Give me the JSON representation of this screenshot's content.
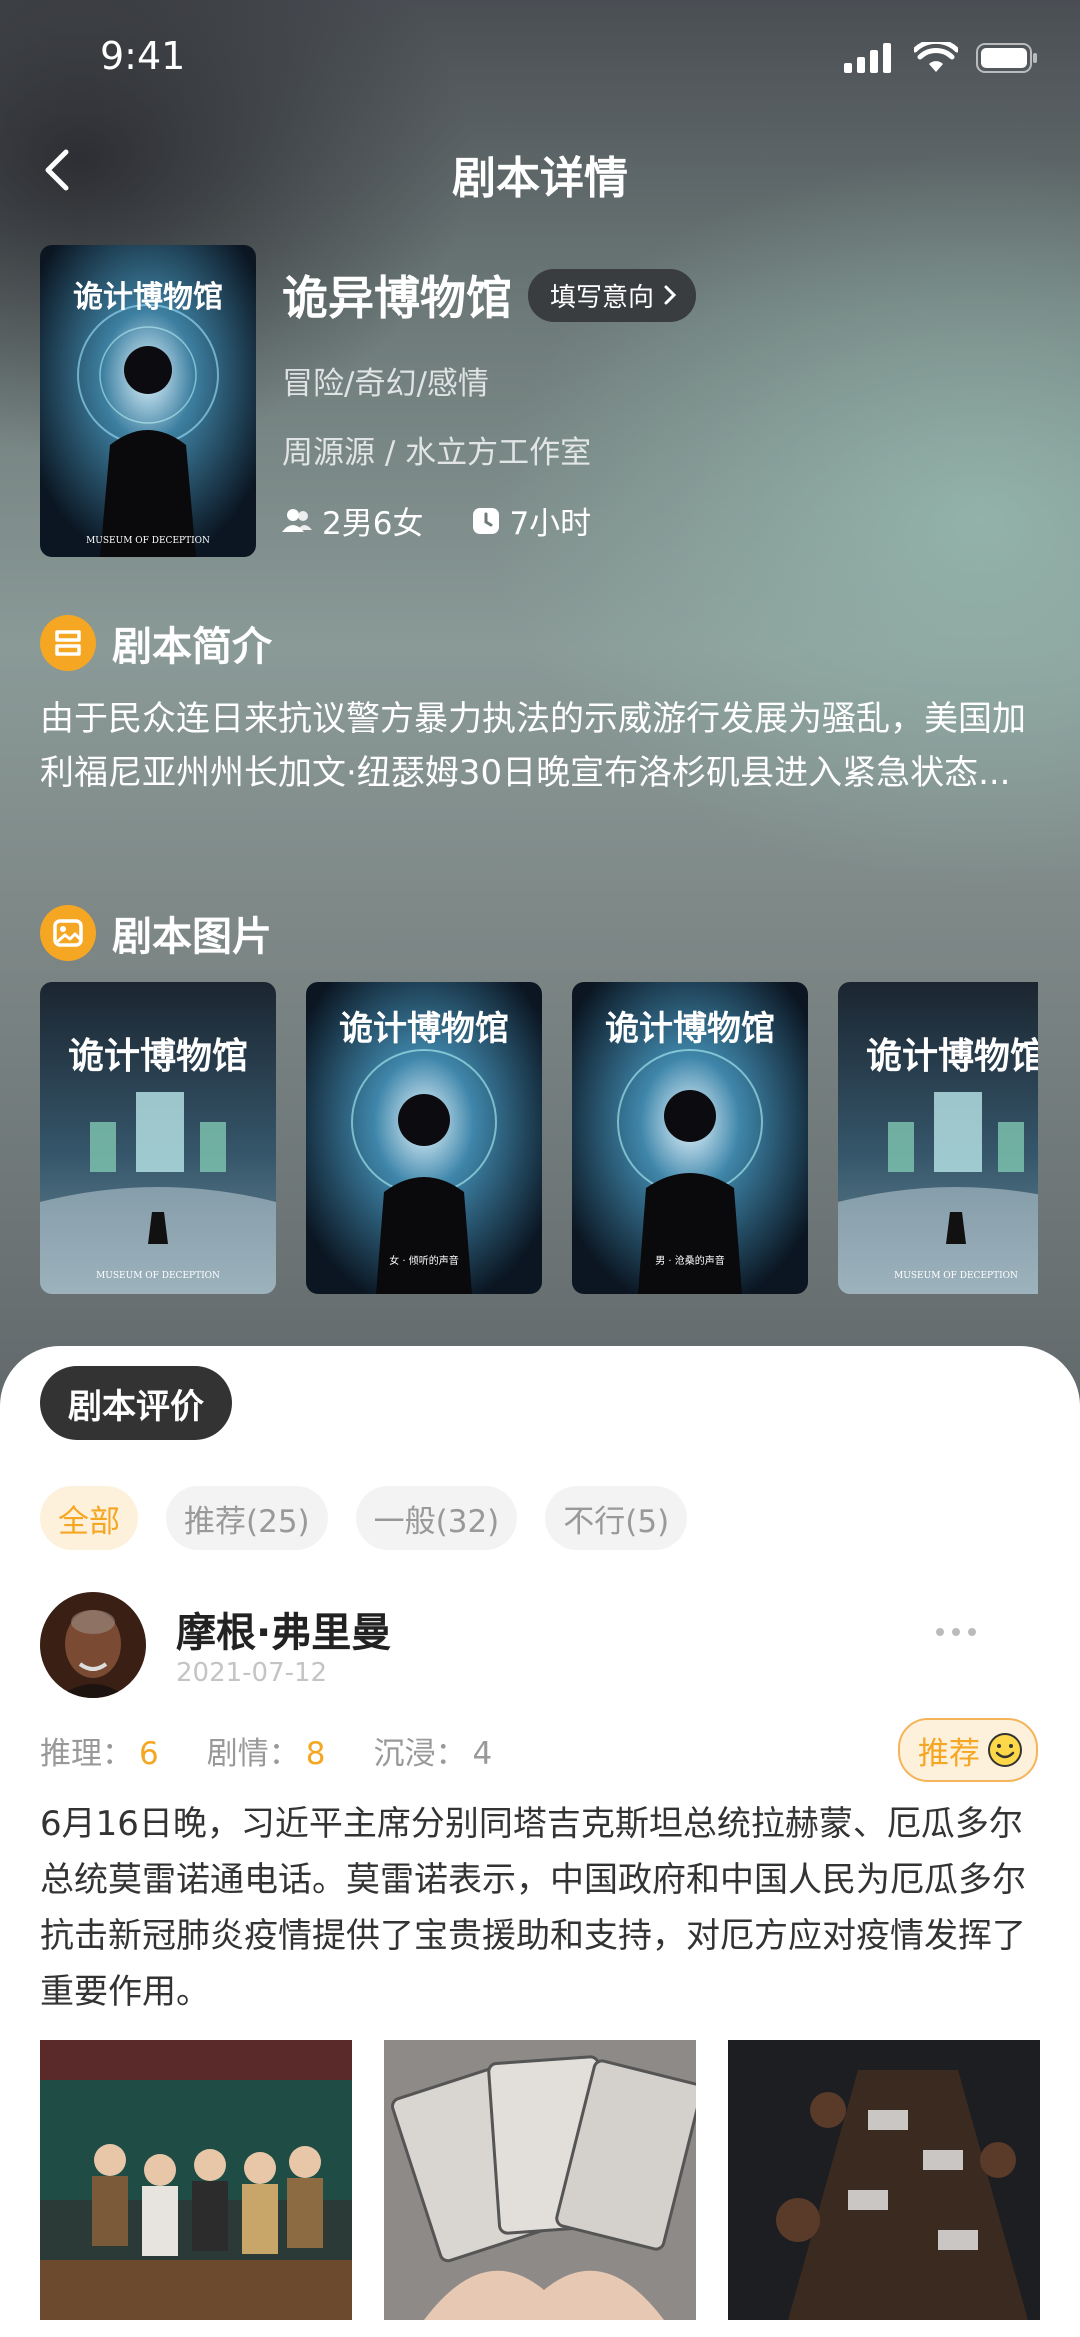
{
  "status_bar": {
    "time": "9:41"
  },
  "nav": {
    "title": "剧本详情"
  },
  "script": {
    "name": "诡异博物馆",
    "intent_label": "填写意向",
    "genre": "冒险/奇幻/感情",
    "author": "周源源 / 水立方工作室",
    "players": "2男6女",
    "duration": "7小时",
    "poster_title": "诡计博物馆",
    "poster_subtitle": "MUSEUM OF DECEPTION"
  },
  "intro": {
    "heading": "剧本简介",
    "text": "由于民众连日来抗议警方暴力执法的示威游行发展为骚乱，美国加利福尼亚州州长加文·纽瑟姆30日晚宣布洛杉矶县进入紧急状态..."
  },
  "images": {
    "heading": "剧本图片",
    "items": [
      {
        "title": "诡计博物馆",
        "caption": "MUSEUM OF DECEPTION",
        "kind": "scene"
      },
      {
        "title": "诡计博物馆",
        "caption": "女 · 倾听的声音",
        "kind": "woman"
      },
      {
        "title": "诡计博物馆",
        "caption": "男 · 沧桑的声音",
        "kind": "man"
      },
      {
        "title": "诡计博物馆",
        "caption": "MUSEUM OF DECEPTION",
        "kind": "scene"
      }
    ]
  },
  "reviews": {
    "heading": "剧本评价",
    "filters": [
      "全部",
      "推荐(25)",
      "一般(32)",
      "不行(5)"
    ],
    "active_filter": 0,
    "items": [
      {
        "user": "摩根·弗里曼",
        "date": "2021-07-12",
        "scores": [
          {
            "label": "推理：",
            "value": "6"
          },
          {
            "label": "剧情：",
            "value": "8"
          },
          {
            "label": "沉浸：",
            "value": "4"
          }
        ],
        "verdict": "推荐",
        "text": "6月16日晚，习近平主席分别同塔吉克斯坦总统拉赫蒙、厄瓜多尔总统莫雷诺通电话。莫雷诺表示，中国政府和中国人民为厄瓜多尔抗击新冠肺炎疫情提供了宝贵援助和支持，对厄方应对疫情发挥了重要作用。"
      }
    ]
  },
  "colors": {
    "accent": "#f5a623",
    "chip_bg": "#f3f3f3",
    "dark_label": "#333333"
  }
}
